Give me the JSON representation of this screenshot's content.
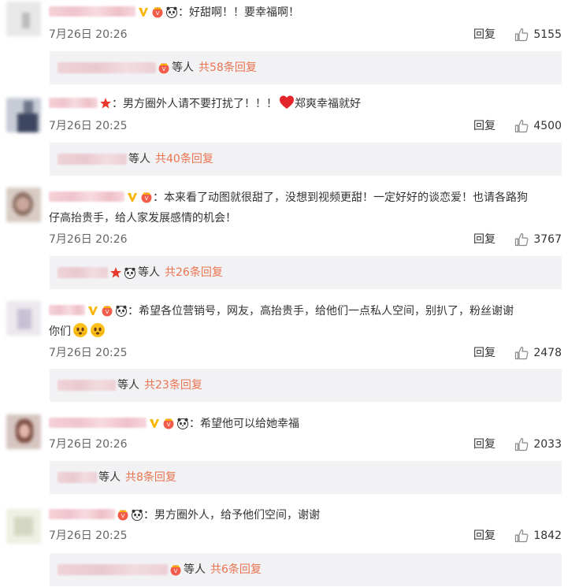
{
  "icons": {
    "like": "thumbs-up-icon",
    "vip": "yellow-v-icon",
    "crown": "vip-crown-icon",
    "panda": "panda-icon",
    "star": "red-star-icon",
    "heart": "red-heart-icon",
    "emoji": "blushing-face-emoji-icon"
  },
  "colors": {
    "accent": "#eb7350",
    "subbox_bg": "#f2f2f5",
    "text": "#333333",
    "meta": "#666666"
  },
  "labels": {
    "reply": "回复",
    "others": "等人"
  },
  "comments": [
    {
      "text": "好甜啊！！要幸福啊！",
      "time": "7月26日 20:26",
      "likes": "5155",
      "sub_count": "共58条回复"
    },
    {
      "text": "男方圈外人请不要打扰了！！！",
      "text_after": "郑爽幸福就好",
      "time": "7月26日 20:25",
      "likes": "4500",
      "sub_count": "共40条回复"
    },
    {
      "text": "本来看了动图就很甜了，没想到视频更甜！一定好好的谈恋爱！也请各路狗",
      "text_line2": "仔高抬贵手，给人家发展感情的机会！",
      "time": "7月26日 20:26",
      "likes": "3767",
      "sub_count": "共26条回复"
    },
    {
      "text": "希望各位营销号，网友，高抬贵手，给他们一点私人空间，别扒了，粉丝谢谢",
      "text_line2": "你们",
      "time": "7月26日 20:25",
      "likes": "2478",
      "sub_count": "共23条回复"
    },
    {
      "text": "希望他可以给她幸福",
      "time": "7月26日 20:26",
      "likes": "2033",
      "sub_count": "共8条回复"
    },
    {
      "text": "男方圈外人，给予他们空间，谢谢",
      "time": "7月26日 20:25",
      "likes": "1842",
      "sub_count": "共6条回复"
    }
  ]
}
